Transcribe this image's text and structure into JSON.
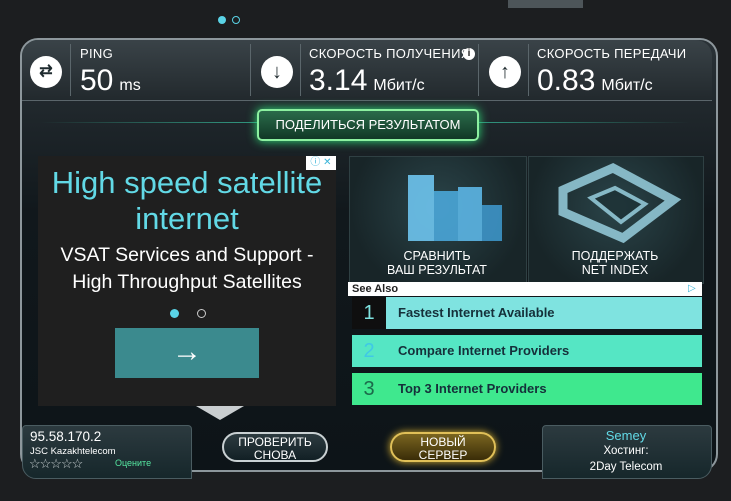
{
  "pager": {
    "active": 0,
    "count": 2
  },
  "stats": {
    "ping": {
      "label": "PING",
      "value": "50",
      "unit": "ms"
    },
    "download": {
      "label": "СКОРОСТЬ ПОЛУЧЕНИЯ",
      "value": "3.14",
      "unit": "Мбит/с"
    },
    "upload": {
      "label": "СКОРОСТЬ ПЕРЕДАЧИ",
      "value": "0.83",
      "unit": "Мбит/с"
    }
  },
  "share_button": "ПОДЕЛИТЬСЯ РЕЗУЛЬТАТОМ",
  "ad": {
    "headline": "High speed satellite internet",
    "subline": "VSAT Services and Support - High Throughput Satellites",
    "arrow": "→"
  },
  "panels": {
    "compare": {
      "line1": "СРАВНИТЬ",
      "line2": "ВАШ РЕЗУЛЬТАТ"
    },
    "support": {
      "line1": "ПОДДЕРЖАТЬ",
      "line2": "NET INDEX"
    }
  },
  "see_also": {
    "label": "See Also",
    "items": [
      {
        "num": "1",
        "text": "Fastest Internet Available"
      },
      {
        "num": "2",
        "text": "Compare Internet Providers"
      },
      {
        "num": "3",
        "text": "Top 3 Internet Providers"
      }
    ]
  },
  "bottom": {
    "ip": "95.58.170.2",
    "isp": "JSC Kazakhtelecom",
    "rate_label": "Оцените",
    "retest": {
      "line1": "ПРОВЕРИТЬ",
      "line2": "СНОВА"
    },
    "new_server": {
      "line1": "НОВЫЙ",
      "line2": "СЕРВЕР"
    },
    "city": "Semey",
    "host_label": "Хостинг:",
    "host": "2Day Telecom"
  },
  "colors": {
    "accent": "#5ad3e6",
    "glow_green": "#2fe07a",
    "gold": "#e0c058"
  }
}
